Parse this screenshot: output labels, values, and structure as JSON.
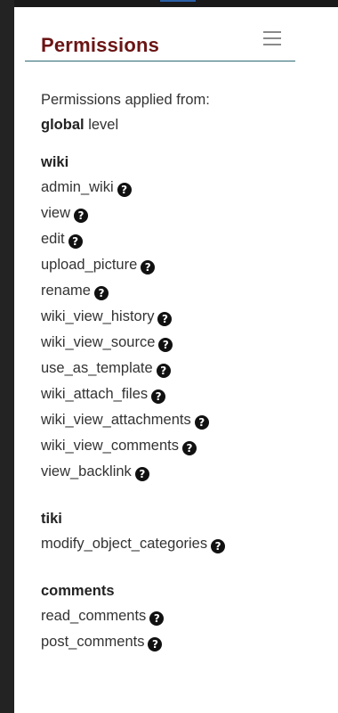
{
  "panel": {
    "title": "Permissions",
    "menu_icon": "hamburger-icon",
    "applied_from_label": "Permissions applied from:",
    "applied_level": "global",
    "applied_level_suffix": "level"
  },
  "help_icon": "question-circle-icon",
  "groups": [
    {
      "title": "wiki",
      "perms": [
        "admin_wiki",
        "view",
        "edit",
        "upload_picture",
        "rename",
        "wiki_view_history",
        "wiki_view_source",
        "use_as_template",
        "wiki_attach_files",
        "wiki_view_attachments",
        "wiki_view_comments",
        "view_backlink"
      ]
    },
    {
      "title": "tiki",
      "perms": [
        "modify_object_categories"
      ]
    },
    {
      "title": "comments",
      "perms": [
        "read_comments",
        "post_comments"
      ]
    }
  ],
  "colors": {
    "title": "#6b1414",
    "divider": "#2e6b73",
    "text": "#333333",
    "background": "#ffffff"
  }
}
